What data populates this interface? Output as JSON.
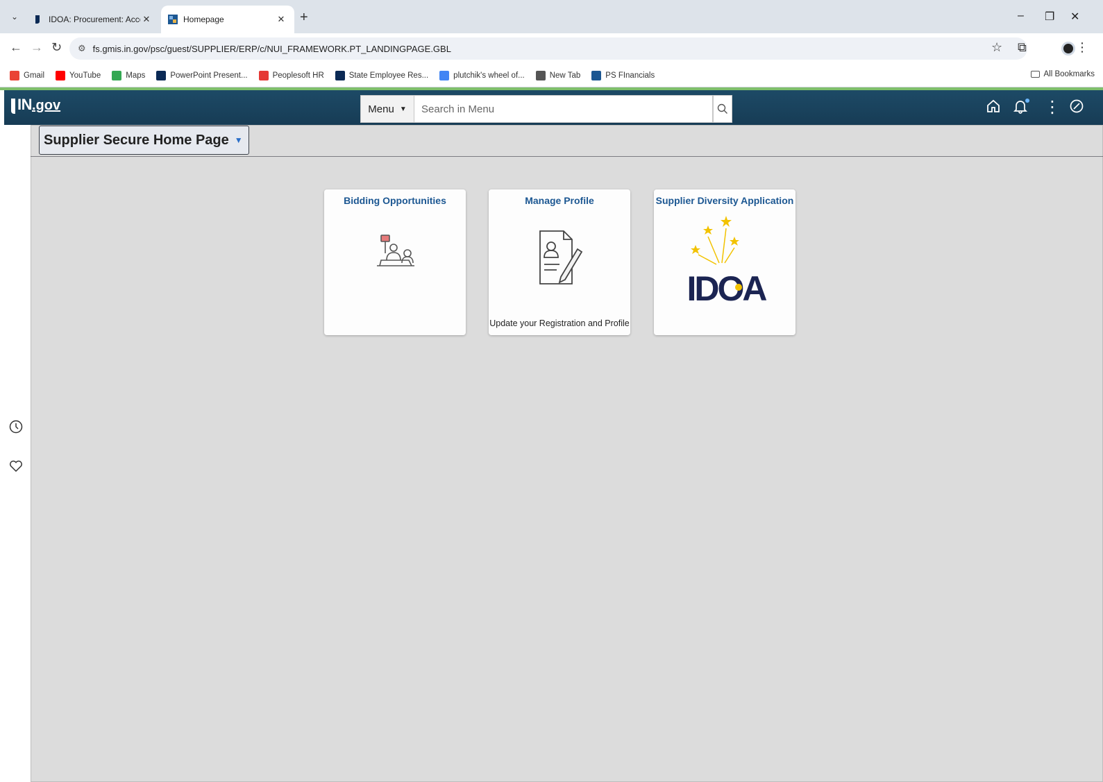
{
  "browser": {
    "tabs": [
      {
        "title": "IDOA: Procurement: Access the",
        "active": false
      },
      {
        "title": "Homepage",
        "active": true
      }
    ],
    "url": "fs.gmis.in.gov/psc/guest/SUPPLIER/ERP/c/NUI_FRAMEWORK.PT_LANDINGPAGE.GBL",
    "bookmarks": [
      {
        "label": "Gmail",
        "icon": "gmail-icon",
        "color": "#ea4335"
      },
      {
        "label": "YouTube",
        "icon": "youtube-icon",
        "color": "#ff0000"
      },
      {
        "label": "Maps",
        "icon": "maps-icon",
        "color": "#34a853"
      },
      {
        "label": "PowerPoint Present...",
        "icon": "in-gov-icon",
        "color": "#0b2a55"
      },
      {
        "label": "Peoplesoft HR",
        "icon": "peoplesoft-icon",
        "color": "#e53935"
      },
      {
        "label": "State Employee Res...",
        "icon": "in-gov-icon",
        "color": "#0b2a55"
      },
      {
        "label": "plutchik's wheel of...",
        "icon": "google-icon",
        "color": "#4285f4"
      },
      {
        "label": "New Tab",
        "icon": "globe-icon",
        "color": "#555555"
      },
      {
        "label": "PS FInancials",
        "icon": "ps-financials-icon",
        "color": "#1c5792"
      }
    ],
    "all_bookmarks": "All Bookmarks"
  },
  "header": {
    "logo_text": "IN",
    "logo_suffix": ".gov",
    "menu_label": "Menu",
    "search_placeholder": "Search in Menu"
  },
  "page": {
    "title": "Supplier Secure Home Page"
  },
  "tiles": [
    {
      "title": "Bidding Opportunities",
      "subtitle": "",
      "icon": "bidding-icon"
    },
    {
      "title": "Manage Profile",
      "subtitle": "Update your Registration and Profile",
      "icon": "profile-document-icon"
    },
    {
      "title": "Supplier Diversity Application",
      "subtitle": "",
      "icon": "idoa-logo",
      "logo_text": "IDOA"
    }
  ],
  "colors": {
    "banner": "#1d4a66",
    "tile_title": "#1c5792",
    "accent_green": "#7fbf6b"
  }
}
